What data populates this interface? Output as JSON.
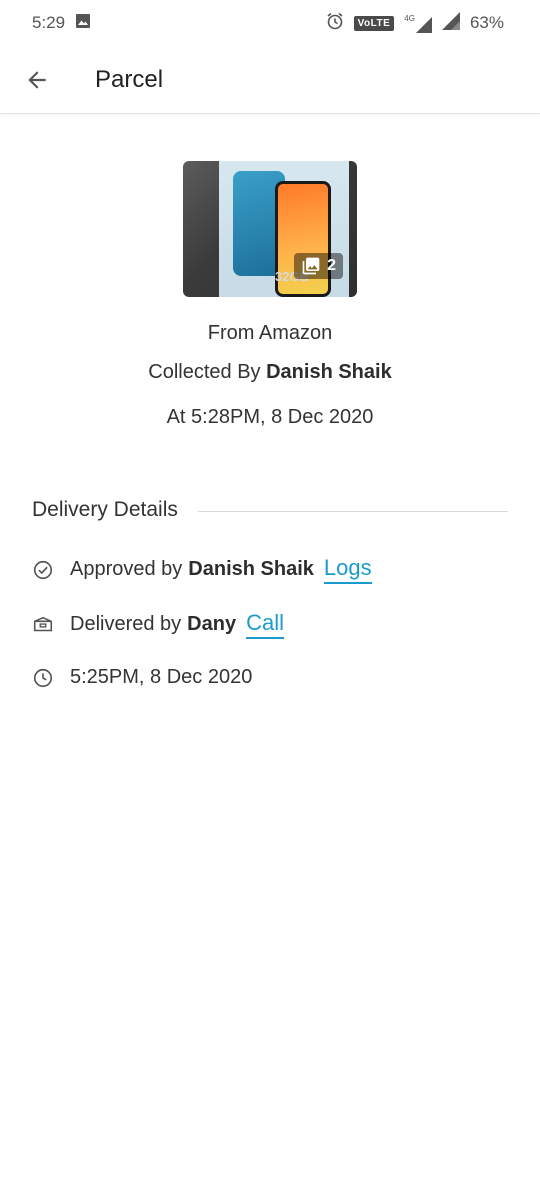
{
  "status_bar": {
    "time": "5:29",
    "volte": "VoLTE",
    "network": "4G",
    "battery": "63%"
  },
  "header": {
    "title": "Parcel"
  },
  "parcel": {
    "photo_count": "2",
    "box_text": "32GB",
    "from_line": "From Amazon",
    "collected_prefix": "Collected By",
    "collected_by": "Danish Shaik",
    "collected_at": "At 5:28PM, 8 Dec 2020"
  },
  "delivery": {
    "section_title": "Delivery Details",
    "approved_prefix": "Approved by",
    "approved_by": "Danish Shaik",
    "logs_link": "Logs",
    "delivered_prefix": "Delivered by",
    "delivered_by": "Dany",
    "call_link": "Call",
    "time": "5:25PM, 8 Dec 2020"
  },
  "colors": {
    "link": "#1a9bcc",
    "text": "#333333"
  }
}
